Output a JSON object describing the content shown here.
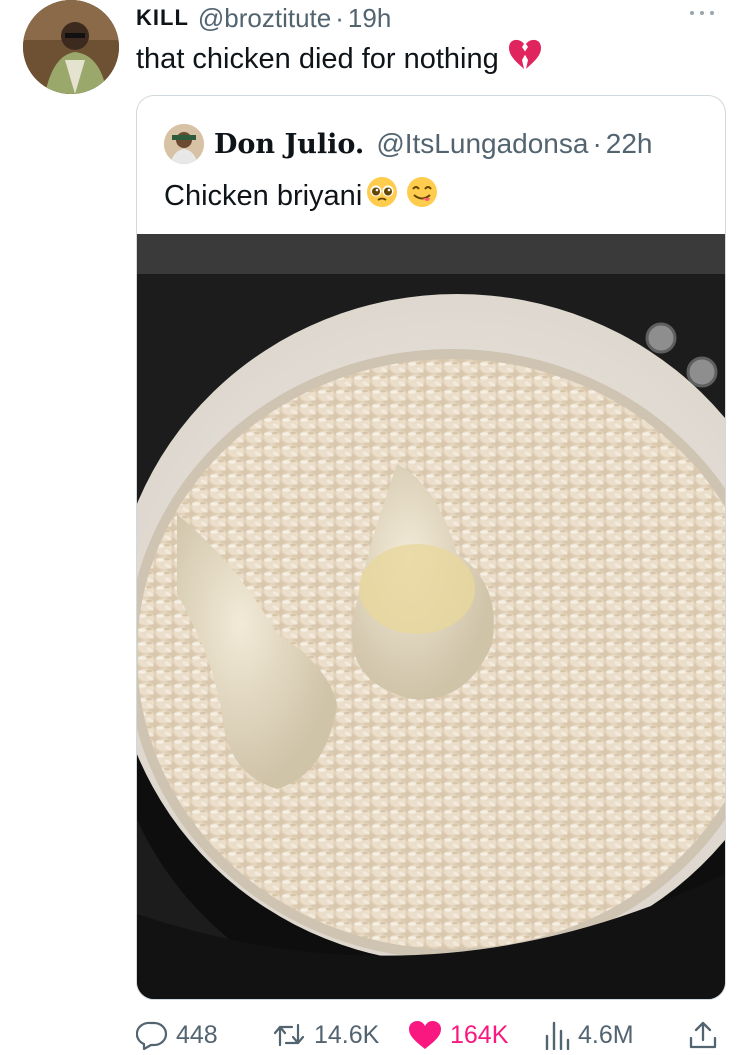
{
  "tweet": {
    "author_name": "KILL",
    "author_handle": "@broztitute",
    "separator": "·",
    "time": "19h",
    "text": "that chicken died for nothing",
    "text_emoji": "broken-heart-icon"
  },
  "quoted_tweet": {
    "author_name": "Don Julio.",
    "author_handle": "@ItsLungadonsa",
    "separator": "·",
    "time": "22h",
    "text": "Chicken briyani",
    "text_emojis": [
      "pleading-face-icon",
      "yum-face-icon"
    ],
    "image": "photo of white rice with chicken drumsticks in a pan"
  },
  "actions": {
    "replies": "448",
    "retweets": "14.6K",
    "likes": "164K",
    "views": "4.6M"
  },
  "colors": {
    "muted": "#536471",
    "like": "#f91880",
    "border": "#cfd9de",
    "heart_emoji": "#e0245e"
  }
}
